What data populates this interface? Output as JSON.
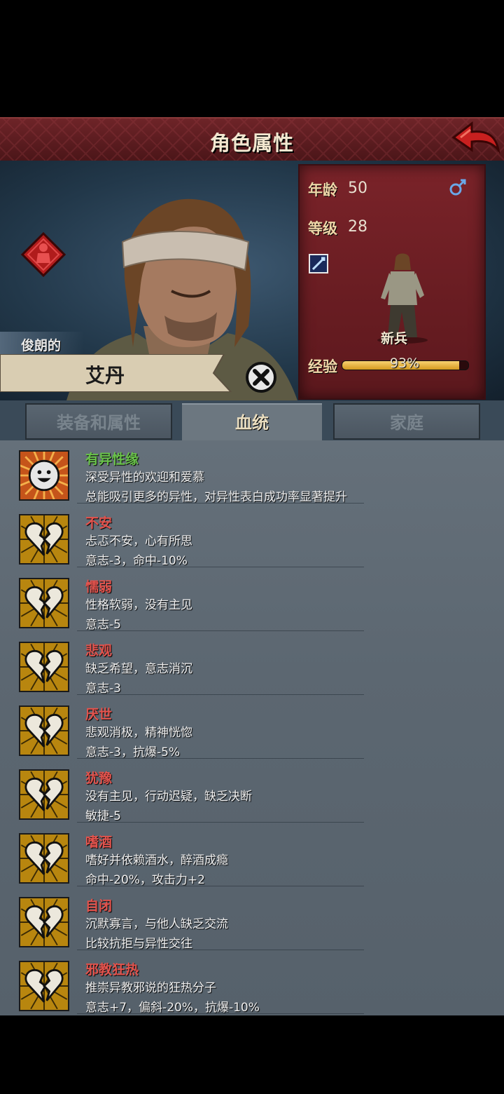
{
  "header": {
    "title": "角色属性"
  },
  "hero": {
    "nickname": "俊朗的",
    "name": "艾丹"
  },
  "stats": {
    "age_label": "年龄",
    "age": "50",
    "level_label": "等级",
    "level": "28",
    "class_name": "新兵",
    "exp_label": "经验",
    "exp_text": "93%",
    "exp_fraction": 0.93
  },
  "tabs": [
    {
      "label": "装备和属性"
    },
    {
      "label": "血统"
    },
    {
      "label": "家庭"
    }
  ],
  "traits": [
    {
      "name": "有异性缘",
      "desc": "深受异性的欢迎和爱慕",
      "effect": "总能吸引更多的异性，对异性表白成功率显著提升",
      "kind": "pos"
    },
    {
      "name": "不安",
      "desc": "忐忑不安，心有所思",
      "effect": "意志-3，命中-10%",
      "kind": "neg"
    },
    {
      "name": "懦弱",
      "desc": "性格软弱，没有主见",
      "effect": "意志-5",
      "kind": "neg"
    },
    {
      "name": "悲观",
      "desc": "缺乏希望，意志消沉",
      "effect": "意志-3",
      "kind": "neg"
    },
    {
      "name": "厌世",
      "desc": "悲观消极，精神恍惚",
      "effect": "意志-3，抗爆-5%",
      "kind": "neg"
    },
    {
      "name": "犹豫",
      "desc": "没有主见，行动迟疑，缺乏决断",
      "effect": "敏捷-5",
      "kind": "neg"
    },
    {
      "name": "嗜酒",
      "desc": "嗜好并依赖酒水，醉酒成瘾",
      "effect": "命中-20%，攻击力+2",
      "kind": "neg"
    },
    {
      "name": "自闭",
      "desc": "沉默寡言，与他人缺乏交流",
      "effect": "比较抗拒与异性交往",
      "kind": "neg"
    },
    {
      "name": "邪教狂热",
      "desc": "推崇异教邪说的狂热分子",
      "effect": "意志+7，偏斜-20%，抗爆-10%",
      "kind": "neg"
    }
  ]
}
